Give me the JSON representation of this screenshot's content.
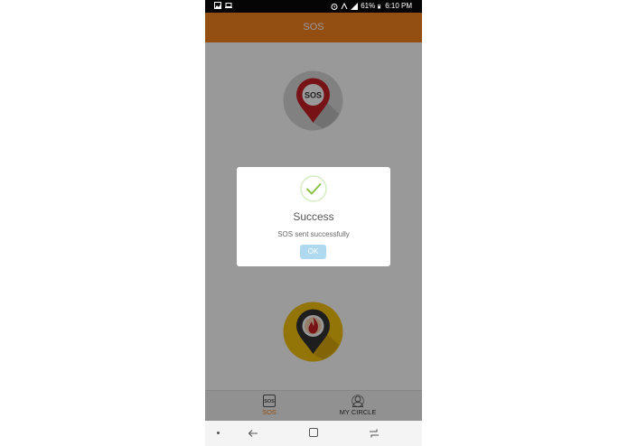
{
  "status_bar": {
    "battery_percent": "61%",
    "time": "6:10 PM",
    "left_icons": [
      "image-icon",
      "laptop-icon"
    ],
    "right_icons": [
      "alarm-icon",
      "volte-icon",
      "signal-icon",
      "battery-icon"
    ]
  },
  "header": {
    "title": "SOS"
  },
  "buttons": {
    "sos_pin_label": "SOS"
  },
  "dialog": {
    "title": "Success",
    "message": "SOS sent successfully",
    "ok_label": "OK"
  },
  "bottom_nav": {
    "items": [
      {
        "label": "SOS",
        "icon": "sos-icon",
        "active": true
      },
      {
        "label": "MY CIRCLE",
        "icon": "person-circle-icon",
        "active": false
      }
    ]
  },
  "colors": {
    "accent": "#f5831f",
    "sos_red": "#c62127",
    "fire_yellow": "#f4c20d",
    "ok_button": "#aed9ee",
    "success_green": "#8bc34a"
  }
}
